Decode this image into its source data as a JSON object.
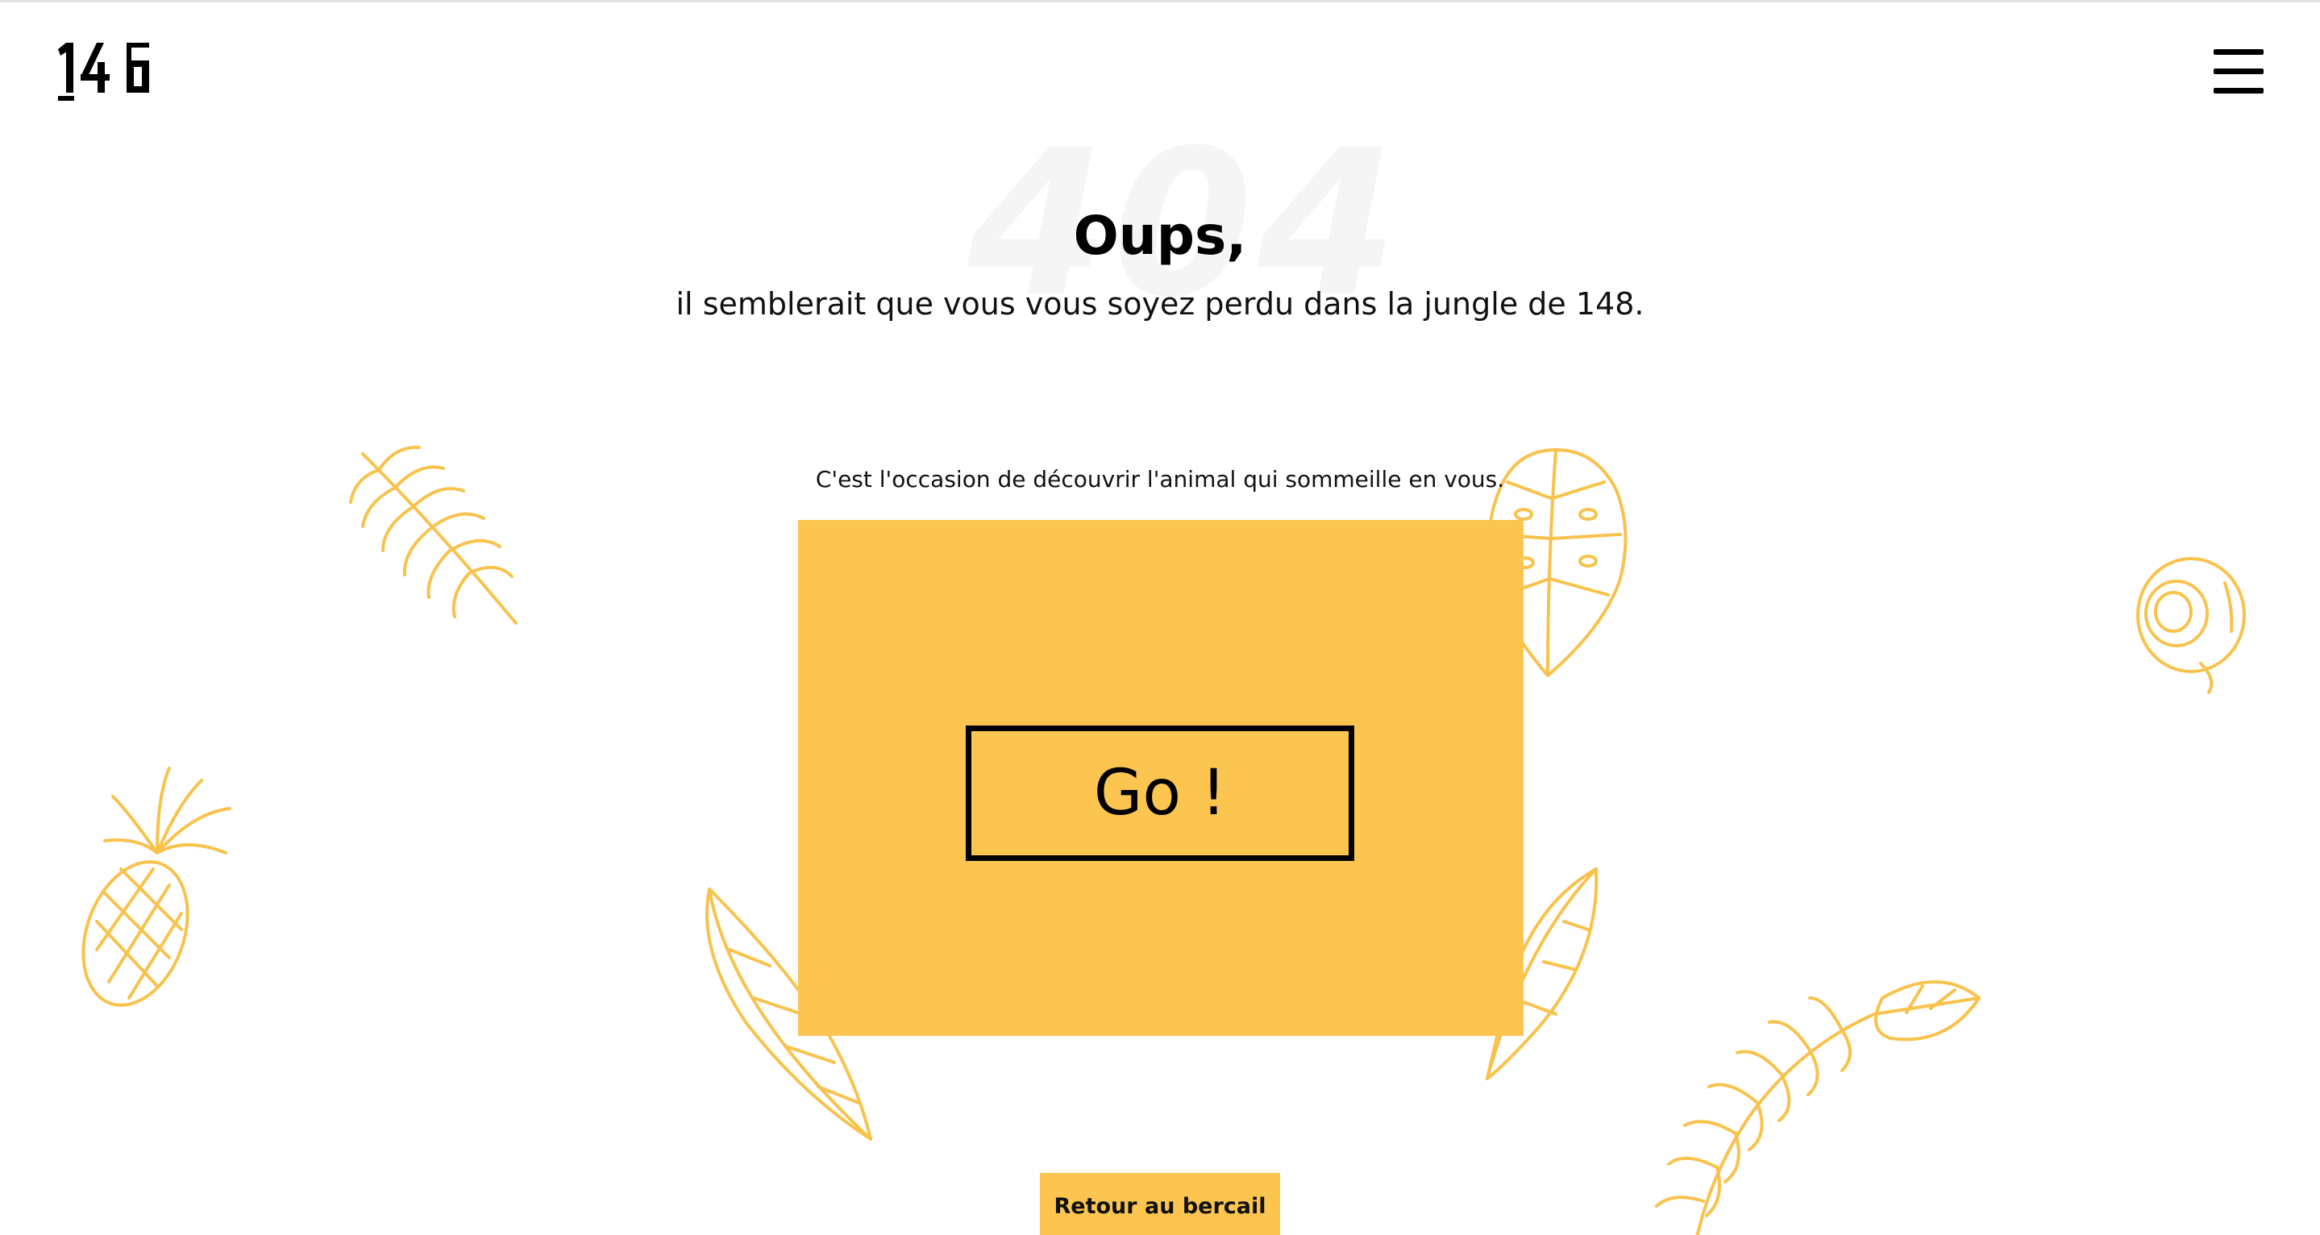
{
  "header": {
    "logo_text": "148",
    "menu_icon": "hamburger-menu-icon"
  },
  "error": {
    "watermark": "404",
    "title": "Oups,",
    "subtitle": "il semblerait que vous vous soyez perdu dans la jungle de 148."
  },
  "game": {
    "intro": "C'est l'occasion de découvrir l'animal qui sommeille en vous.",
    "go_label": "Go !"
  },
  "footer": {
    "return_label": "Retour au bercail"
  },
  "decorations": [
    "palm-leaf-icon",
    "monstera-leaf-icon",
    "coconut-icon",
    "pineapple-icon",
    "banana-leaf-icon",
    "feather-leaf-icon",
    "fern-branch-icon"
  ],
  "colors": {
    "accent": "#fbc550",
    "illustration": "#f8c24c",
    "text": "#000000",
    "background": "#ffffff"
  }
}
